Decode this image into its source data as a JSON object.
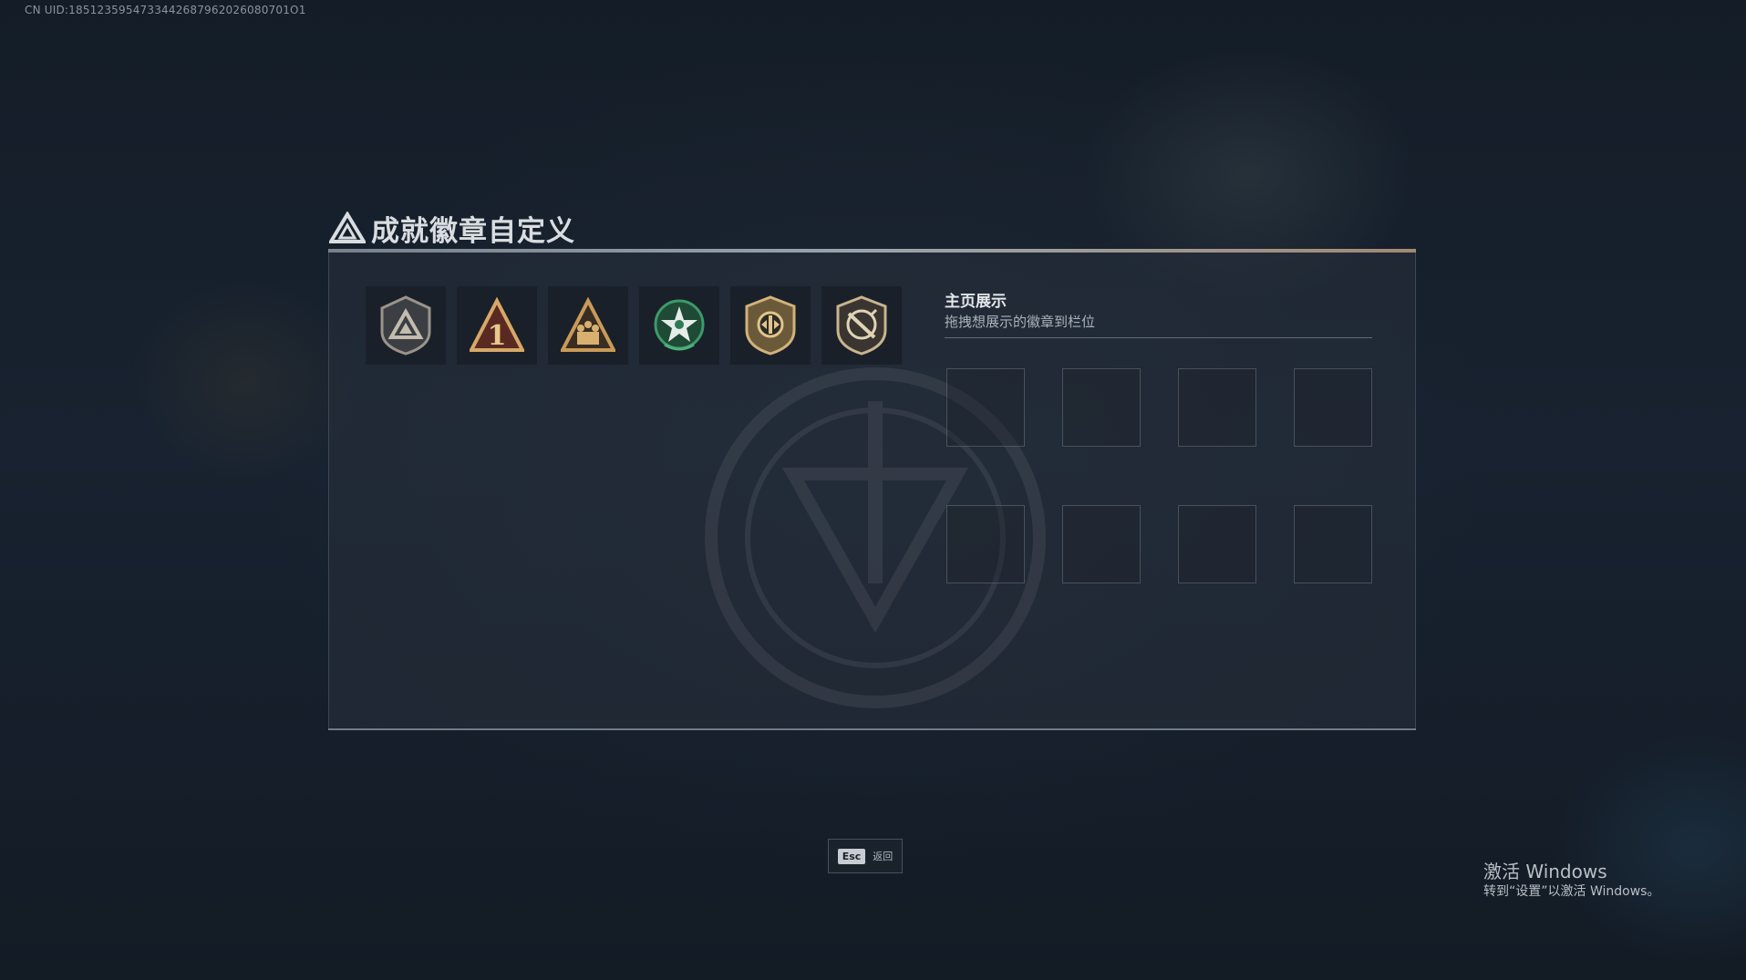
{
  "header": {
    "uid_text": "CN UID:1851235954733442687962026080701O1"
  },
  "dialog": {
    "title": "成就徽章自定义",
    "title_icon": "triangle-logo-icon"
  },
  "badges": [
    {
      "name": "shield-triangle-badge-icon"
    },
    {
      "name": "triangle-number-one-badge-icon"
    },
    {
      "name": "triangle-soldiers-badge-icon"
    },
    {
      "name": "green-star-wreath-badge-icon"
    },
    {
      "name": "gold-shield-emblem-badge-icon"
    },
    {
      "name": "crossed-sword-shield-badge-icon"
    }
  ],
  "showcase": {
    "title": "主页展示",
    "subtitle": "拖拽想展示的徽章到栏位",
    "slot_count": 8
  },
  "footer": {
    "esc_key": "Esc",
    "esc_label": "返回"
  },
  "windows_watermark": {
    "title": "激活 Windows",
    "subtitle": "转到“设置”以激活 Windows。"
  },
  "colors": {
    "background": "#131b24",
    "panel": "#283038",
    "accent_gold": "#c8a060",
    "accent_green": "#3a8a5a"
  }
}
